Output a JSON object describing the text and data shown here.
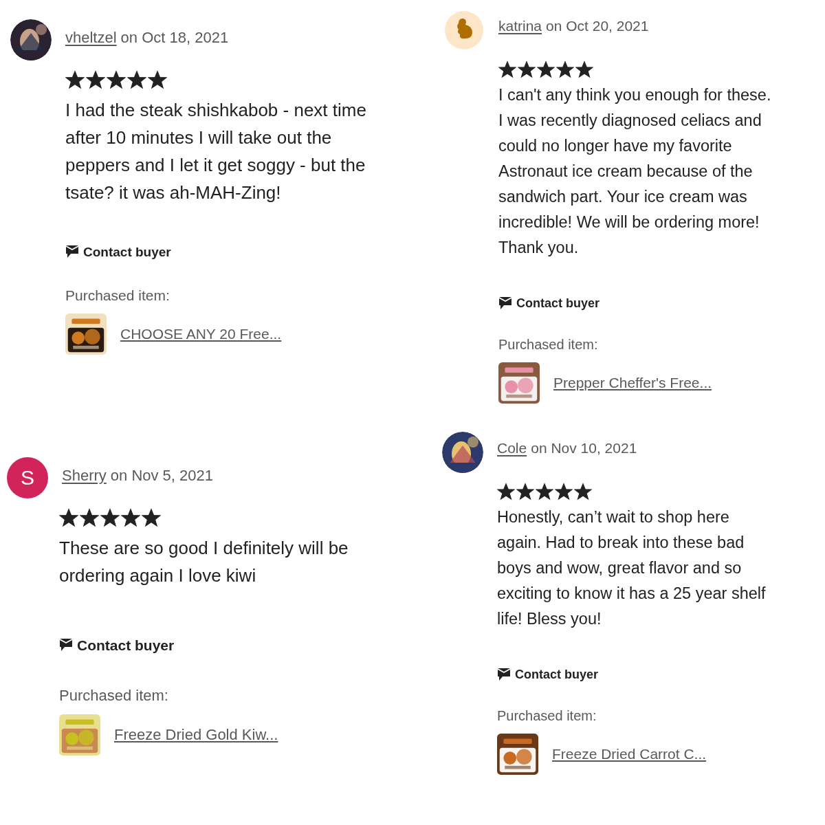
{
  "columns": [
    {
      "reviews": [
        {
          "user": "vheltzel",
          "date": "on Oct 18, 2021",
          "stars": 5,
          "text": "I had the steak shishkabob - next time after 10 minutes I will take out the peppers and I let it get soggy - but the tsate? it was ah-MAH-Zing!",
          "contact": "Contact buyer",
          "purchased_label": "Purchased item:",
          "item": {
            "title": "CHOOSE ANY 20 Free..."
          }
        },
        {
          "avatar": {
            "kind": "letter",
            "letter": "S",
            "color": "#d1245a"
          },
          "user": "Sherry",
          "date": "on Nov 5, 2021",
          "stars": 5,
          "text": "These are so good I definitely will be ordering again I love kiwi",
          "contact": "Contact buyer",
          "purchased_label": "Purchased item:",
          "item": {
            "title": "Freeze Dried Gold Kiw..."
          }
        }
      ]
    },
    {
      "reviews": [
        {
          "avatar": {
            "kind": "blob"
          },
          "user": "katrina",
          "date": "on Oct 20, 2021",
          "stars": 5,
          "text": "I can't any think you enough for these. I was recently diagnosed celiacs and could no longer have my favorite Astronaut ice cream because of the sandwich part. Your ice cream was incredible! We will be ordering more! Thank you.",
          "contact": "Contact buyer",
          "purchased_label": "Purchased item:",
          "item": {
            "title": "Prepper Cheffer's Free..."
          }
        },
        {
          "user": "Cole",
          "date": "on Nov 10, 2021",
          "stars": 5,
          "text": "Honestly, can’t wait to shop here again. Had to break into these bad boys and wow, great flavor and so exciting to know it has a 25 year shelf life! Bless you!",
          "contact": "Contact buyer",
          "purchased_label": "Purchased item:",
          "item": {
            "title": "Freeze Dried Carrot C..."
          }
        }
      ]
    }
  ]
}
